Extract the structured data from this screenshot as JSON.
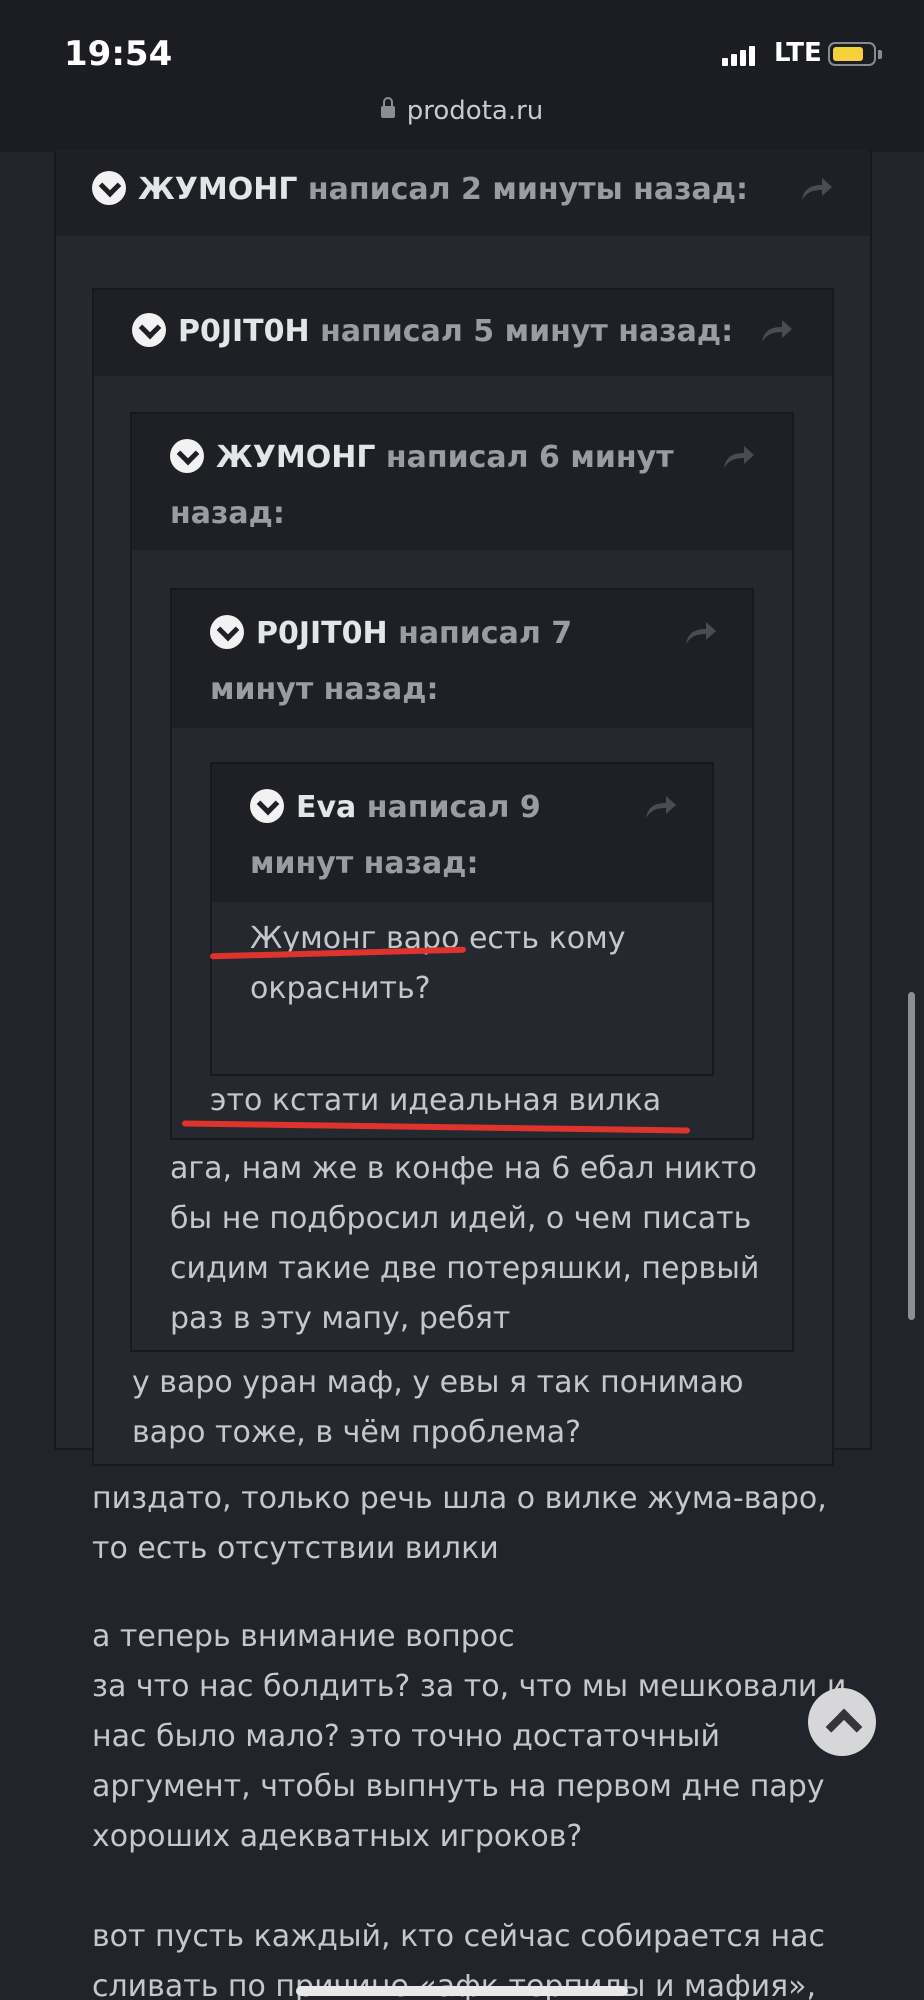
{
  "status_bar": {
    "time": "19:54",
    "network": "LTE",
    "url": "prodota.ru"
  },
  "quotes": [
    {
      "author": "ЖУМОНГ",
      "meta": " написал 2 минуты назад:"
    },
    {
      "author": "P0JIT0H",
      "meta": " написал 5 минут назад:",
      "body": "у варо уран маф, у евы я так понимаю варо тоже, в чём проблема?"
    },
    {
      "author": "ЖУМОНГ",
      "meta_line1": " написал 6 минут",
      "meta_line2": "назад:",
      "body": "ага, нам же в конфе на 6 ебал никто бы не подбросил идей, о чем писать сидим такие две потеряшки, первый раз в эту мапу, ребят"
    },
    {
      "author": "P0JIT0H",
      "meta_line1": " написал 7",
      "meta_line2": "минут назад:",
      "body": "это кстати идеальная вилка"
    },
    {
      "author": "Eva",
      "meta_line1": " написал 9",
      "meta_line2": "минут назад:",
      "body": "Жумонг варо есть кому окраснить?"
    }
  ],
  "post_text": [
    "пиздато, только речь шла о вилке жума-варо, то есть отсутствии вилки",
    "а теперь внимание вопрос",
    "за что нас болдить? за то, что мы мешковали и нас было мало? это точно достаточный аргумент, чтобы выпнуть на первом дне пару хороших адекватных игроков?",
    "вот пусть каждый, кто сейчас собирается нас сливать по причине «афк терпилы и мафия»,"
  ],
  "colors": {
    "underline": "#e0332b",
    "background": "#22242b",
    "quote_header": "#1e2025"
  }
}
